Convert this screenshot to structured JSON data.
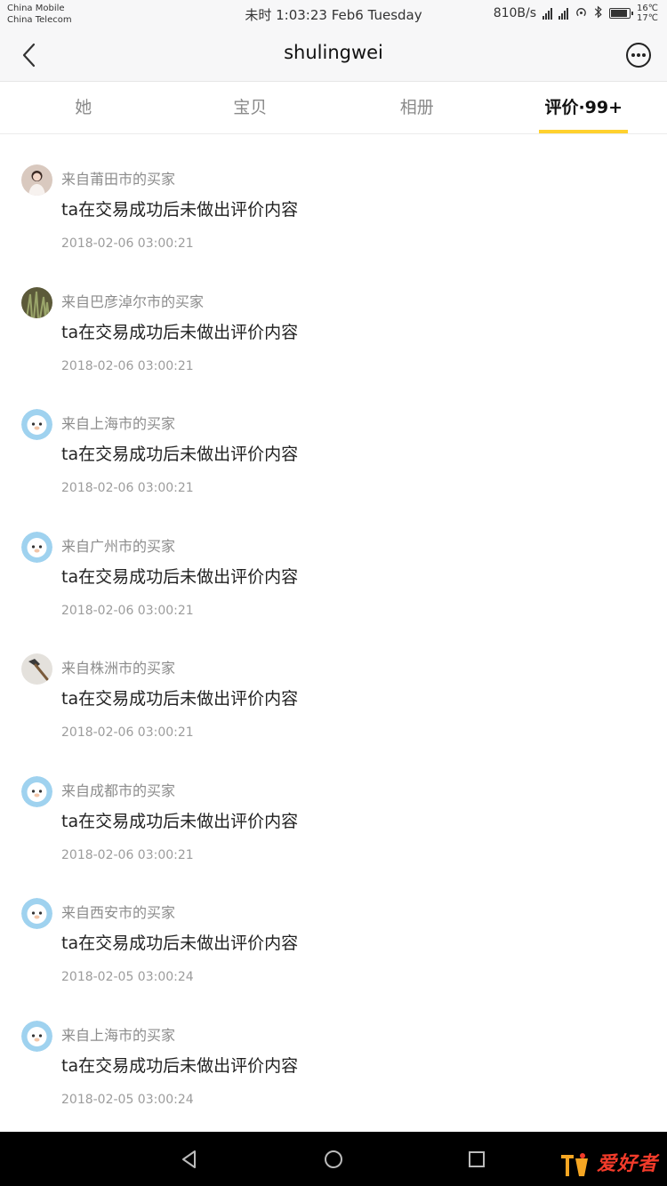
{
  "status_bar": {
    "carrier_1": "China Mobile",
    "carrier_2": "China Telecom",
    "time": "未时 1:03:23 Feb6 Tuesday",
    "net_speed": "810B/s",
    "temp_1": "16℃",
    "temp_2": "17℃"
  },
  "nav": {
    "title": "shulingwei"
  },
  "tabs": [
    {
      "label": "她",
      "active": false
    },
    {
      "label": "宝贝",
      "active": false
    },
    {
      "label": "相册",
      "active": false
    },
    {
      "label": "评价·99+",
      "active": true
    }
  ],
  "reviews": [
    {
      "from": "来自莆田市的买家",
      "text": "ta在交易成功后未做出评价内容",
      "date": "2018-02-06 03:00:21",
      "avatar": "photo-person"
    },
    {
      "from": "来自巴彦淖尔市的买家",
      "text": "ta在交易成功后未做出评价内容",
      "date": "2018-02-06 03:00:21",
      "avatar": "photo-plants"
    },
    {
      "from": "来自上海市的买家",
      "text": "ta在交易成功后未做出评价内容",
      "date": "2018-02-06 03:00:21",
      "avatar": "default-mascot"
    },
    {
      "from": "来自广州市的买家",
      "text": "ta在交易成功后未做出评价内容",
      "date": "2018-02-06 03:00:21",
      "avatar": "default-mascot"
    },
    {
      "from": "来自株洲市的买家",
      "text": "ta在交易成功后未做出评价内容",
      "date": "2018-02-06 03:00:21",
      "avatar": "photo-hammer"
    },
    {
      "from": "来自成都市的买家",
      "text": "ta在交易成功后未做出评价内容",
      "date": "2018-02-06 03:00:21",
      "avatar": "default-mascot"
    },
    {
      "from": "来自西安市的买家",
      "text": "ta在交易成功后未做出评价内容",
      "date": "2018-02-05 03:00:24",
      "avatar": "default-mascot"
    },
    {
      "from": "来自上海市的买家",
      "text": "ta在交易成功后未做出评价内容",
      "date": "2018-02-05 03:00:24",
      "avatar": "default-mascot"
    }
  ],
  "watermark": {
    "text": "爱好者"
  },
  "colors": {
    "accent": "#ffd12e",
    "system_nav": "#000000",
    "watermark": "#f23b2a"
  }
}
